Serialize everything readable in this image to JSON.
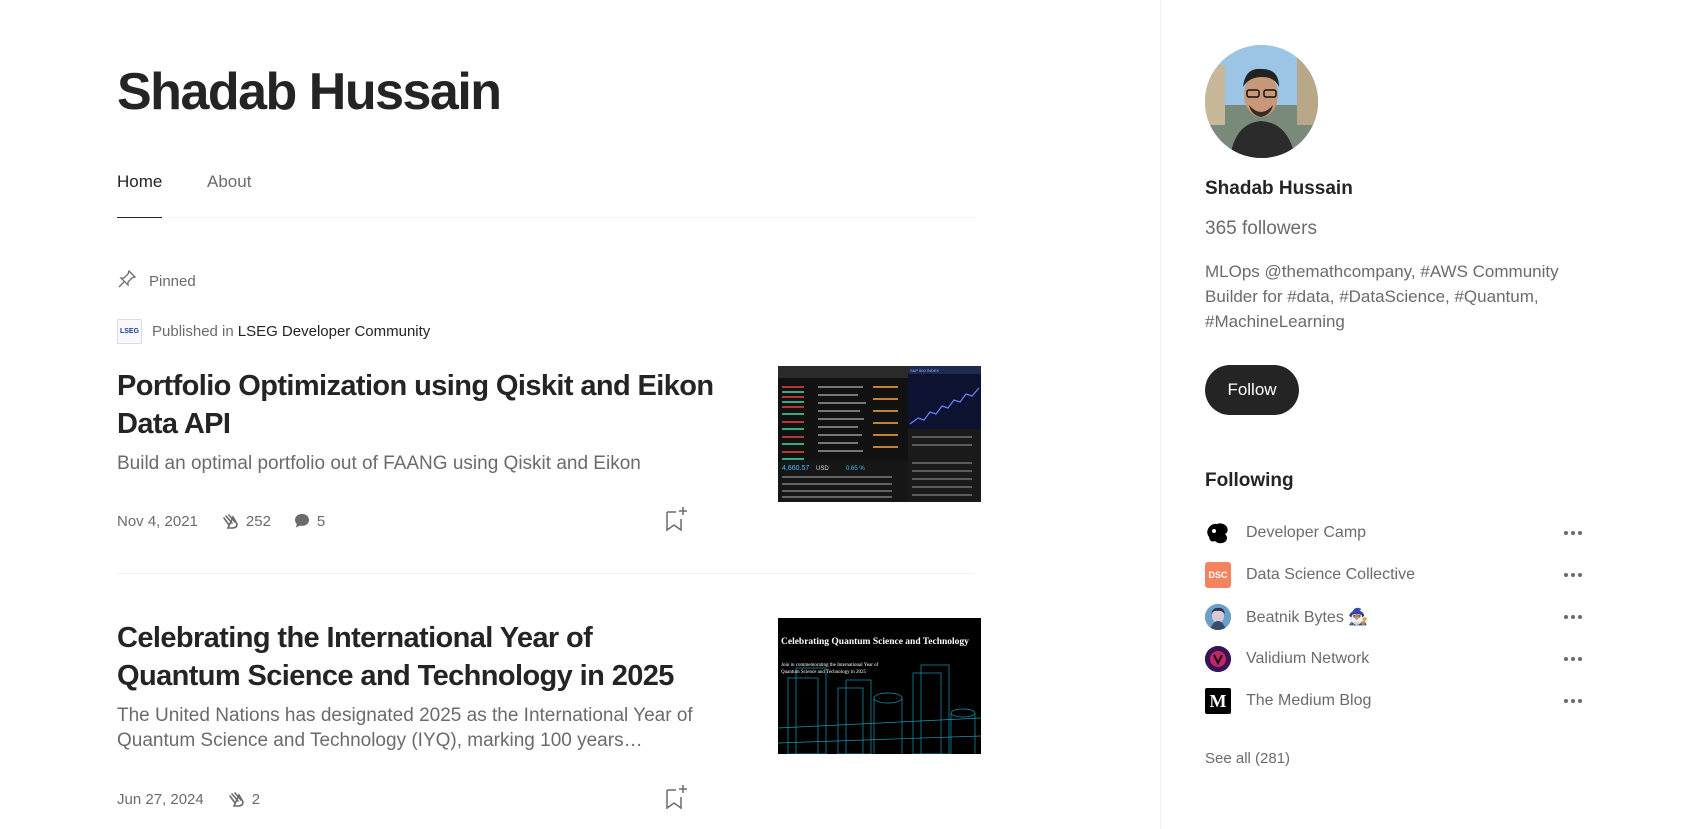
{
  "profile": {
    "name": "Shadab Hussain"
  },
  "tabs": [
    {
      "label": "Home",
      "active": true
    },
    {
      "label": "About",
      "active": false
    }
  ],
  "pinned_label": "Pinned",
  "articles": [
    {
      "published_prefix": "Published in",
      "publication": "LSEG Developer Community",
      "publication_logo_text": "LSEG",
      "title": "Portfolio Optimization using Qiskit and Eikon Data API",
      "subtitle": "Build an optimal portfolio out of FAANG using Qiskit and Eikon",
      "date": "Nov 4, 2021",
      "claps": "252",
      "comments": "5",
      "thumb": {
        "header": "S&P 500 INDEX",
        "price": "4,660.57",
        "currency": "USD",
        "change": "0.65 %"
      }
    },
    {
      "title": "Celebrating the International Year of Quantum Science and Technology in 2025",
      "subtitle": "The United Nations has designated 2025 as the International Year of Quantum Science and Technology (IYQ), marking 100 years…",
      "date": "Jun 27, 2024",
      "claps": "2",
      "thumb": {
        "title": "Celebrating Quantum Science and Technology",
        "caption_line1": "Join in commemorating the International Year of",
        "caption_line2": "Quantum Science and Technology in 2025"
      }
    }
  ],
  "sidebar": {
    "name": "Shadab Hussain",
    "followers": "365 followers",
    "bio": "MLOps @themathcompany, #AWS Community Builder for #data, #DataScience, #Quantum, #MachineLearning",
    "follow_label": "Follow",
    "following_heading": "Following",
    "following": [
      {
        "name": "Developer Camp",
        "icon": "developer-camp-logo",
        "color": "#000000"
      },
      {
        "name": "Data Science Collective",
        "icon": "dsc-logo",
        "icon_text": "DSC",
        "color": "#f4845f"
      },
      {
        "name": "Beatnik Bytes 🧙🏽‍♂️",
        "icon": "beatnik-bytes-avatar",
        "color": "#5a8fb8"
      },
      {
        "name": "Validium Network",
        "icon": "validium-logo",
        "color": "#4b1f6b"
      },
      {
        "name": "The Medium Blog",
        "icon": "medium-logo",
        "icon_text": "M",
        "color": "#000000"
      }
    ],
    "see_all": "See all (281)"
  },
  "colors": {
    "text": "#242424",
    "muted": "#6b6b6b",
    "border": "#f2f2f2",
    "button": "#242424"
  }
}
